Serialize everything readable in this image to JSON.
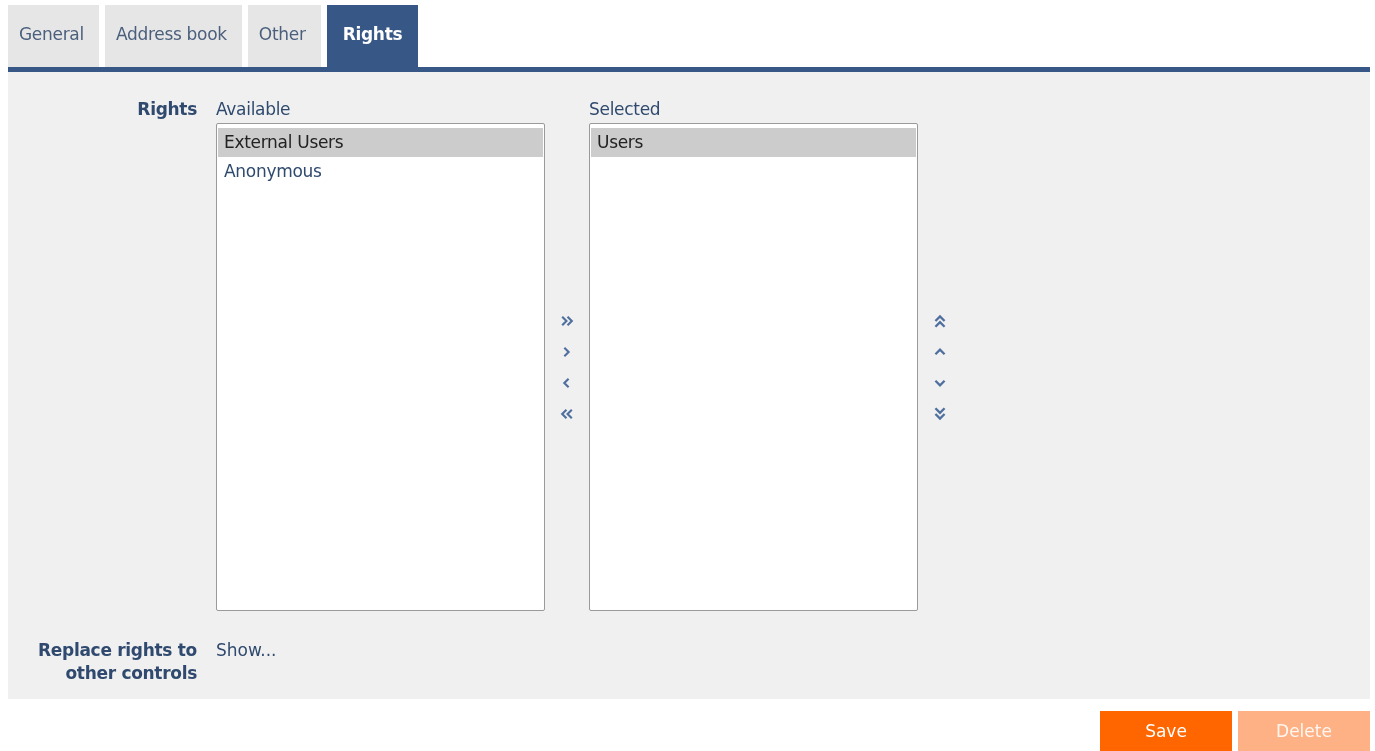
{
  "tabs": [
    {
      "label": "General",
      "selected": false
    },
    {
      "label": "Address book",
      "selected": false
    },
    {
      "label": "Other",
      "selected": false
    },
    {
      "label": "Rights",
      "selected": true
    }
  ],
  "rights": {
    "label": "Rights",
    "lists": [
      {
        "label": "Available",
        "items": [
          {
            "text": "External Users",
            "selected": true
          },
          {
            "text": "Anonymous",
            "selected": false
          }
        ]
      },
      {
        "label": "Selected",
        "items": [
          {
            "text": "Users",
            "selected": true
          }
        ]
      }
    ]
  },
  "replace": {
    "label": "Replace rights to other controls",
    "link": "Show..."
  },
  "buttons": [
    {
      "label": "Save",
      "disabled": false
    },
    {
      "label": "Delete",
      "disabled": true
    }
  ]
}
